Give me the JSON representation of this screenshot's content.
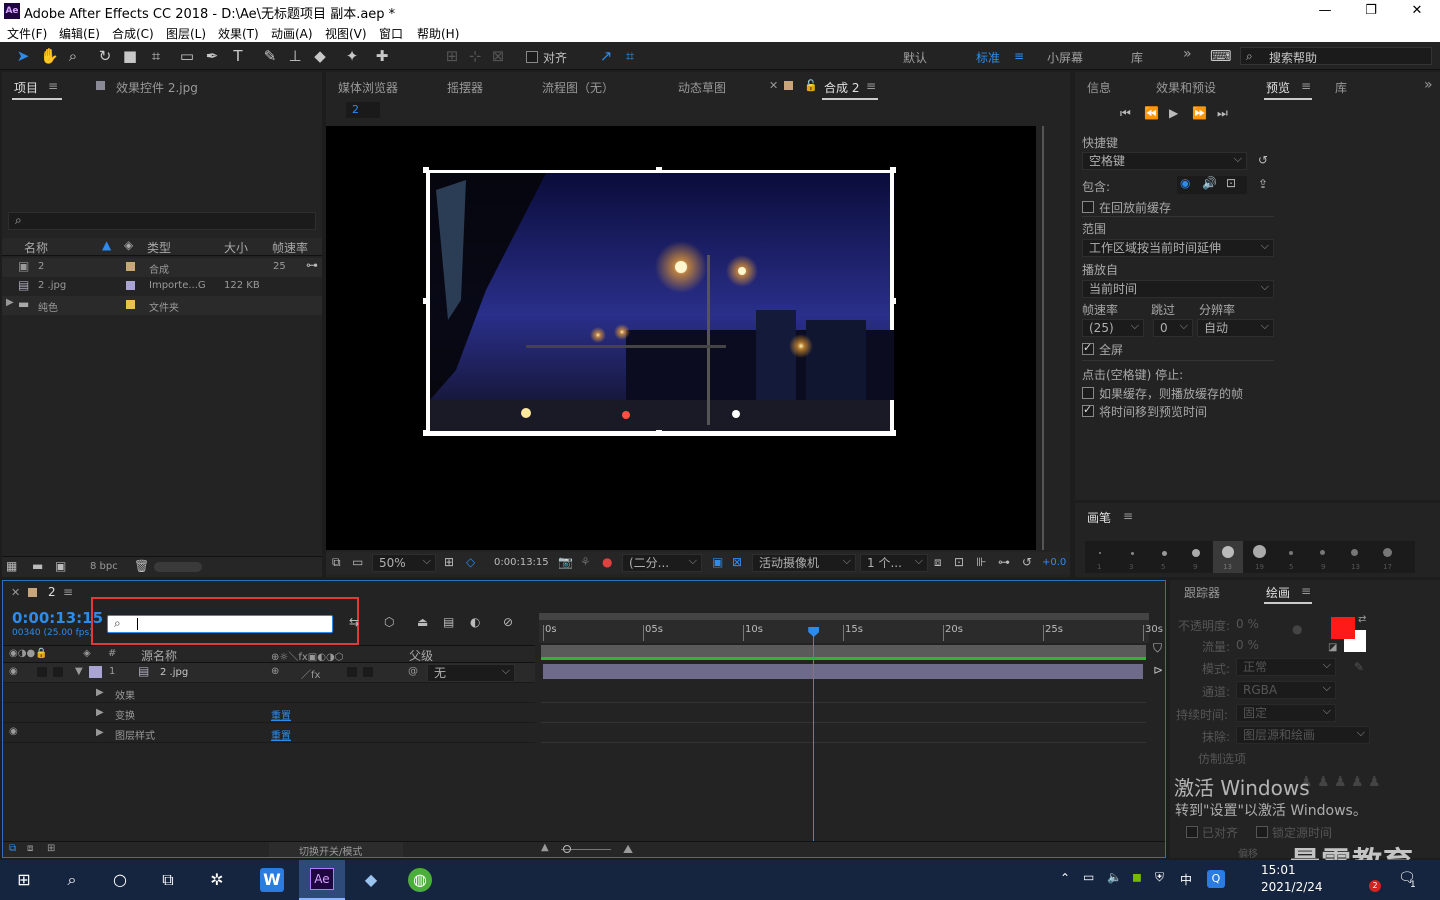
{
  "window": {
    "title": "Adobe After Effects CC 2018 - D:\\Ae\\无标题项目 副本.aep *",
    "logo": "Ae"
  },
  "menu": [
    "文件(F)",
    "编辑(E)",
    "合成(C)",
    "图层(L)",
    "效果(T)",
    "动画(A)",
    "视图(V)",
    "窗口",
    "帮助(H)"
  ],
  "toolbar": {
    "snap_label": "对齐",
    "workspaces": [
      "默认",
      "标准",
      "小屏幕",
      "库"
    ],
    "search_placeholder": "搜索帮助"
  },
  "project": {
    "tab": "项目",
    "effects_tab": "效果控件 2.jpg",
    "columns": [
      "名称",
      "类型",
      "大小",
      "帧速率"
    ],
    "rows": [
      {
        "name": "2",
        "type": "合成",
        "size": "",
        "fps": "25",
        "color": "#c8a57a"
      },
      {
        "name": "2 .jpg",
        "type": "Importe...G",
        "size": "122 KB",
        "fps": "",
        "color": "#a9a4d4"
      },
      {
        "name": "纯色",
        "type": "文件夹",
        "size": "",
        "fps": "",
        "color": "#e8c24a"
      }
    ],
    "bpc": "8 bpc"
  },
  "viewer": {
    "tabs": [
      "媒体浏览器",
      "摇摆器",
      "流程图（无）",
      "动态草图",
      "合成 2"
    ],
    "comp_name": "2",
    "zoom": "50%",
    "timecode": "0:00:13:15",
    "resolution": "(二分...",
    "camera": "活动摄像机",
    "views": "1 个...",
    "exposure": "+0.0"
  },
  "right": {
    "tabs": [
      "信息",
      "效果和预设",
      "预览",
      "库"
    ],
    "shortcut_label": "快捷键",
    "shortcut_value": "空格键",
    "include_label": "包含:",
    "cache_before": "在回放前缓存",
    "range_label": "范围",
    "range_value": "工作区域按当前时间延伸",
    "play_from_label": "播放自",
    "play_from_value": "当前时间",
    "fps_label": "帧速率",
    "skip_label": "跳过",
    "res_label": "分辨率",
    "fps_value": "(25)",
    "skip_value": "0",
    "res_value": "自动",
    "fullscreen": "全屏",
    "click_stop": "点击(空格键) 停止:",
    "if_cached": "如果缓存，则播放缓存的帧",
    "move_time": "将时间移到预览时间",
    "brush_tab": "画笔",
    "brush_sizes": [
      "1",
      "3",
      "5",
      "9",
      "13",
      "19",
      "5",
      "9",
      "13",
      "17"
    ]
  },
  "paint": {
    "tabs": [
      "跟踪器",
      "绘画"
    ],
    "opacity_label": "不透明度:",
    "opacity_value": "0 %",
    "flow_label": "流量:",
    "flow_value": "0 %",
    "mode_label": "模式:",
    "mode_value": "正常",
    "channel_label": "通道:",
    "channel_value": "RGBA",
    "duration_label": "持续时间:",
    "duration_value": "固定",
    "erase_label": "抹除:",
    "erase_value": "图层源和绘画",
    "clone_label": "仿制选项",
    "aligned": "已对齐",
    "lock_source": "锁定源时间",
    "offset_label": "偏移",
    "color_fg": "#ff1a1a"
  },
  "timeline": {
    "tab": "2",
    "timecode": "0:00:13:15",
    "frame_info": "00340 (25.00 fps)",
    "col_source": "源名称",
    "col_parent": "父级",
    "col_hash": "#",
    "layer": {
      "index": "1",
      "name": "2 .jpg",
      "parent": "无"
    },
    "props": [
      "效果",
      "变换",
      "图层样式"
    ],
    "reset": "重置",
    "ruler": [
      "0s",
      "05s",
      "10s",
      "15s",
      "20s",
      "25s",
      "30s"
    ],
    "playhead_pct": 45,
    "toggle_label": "切换开关/模式"
  },
  "watermark": {
    "line1": "激活 Windows",
    "line2": "转到\"设置\"以激活 Windows。",
    "brand": "最需教育"
  },
  "taskbar": {
    "time": "15:01",
    "date": "2021/2/24",
    "ime": "中",
    "badge": "2",
    "notif": "1"
  }
}
